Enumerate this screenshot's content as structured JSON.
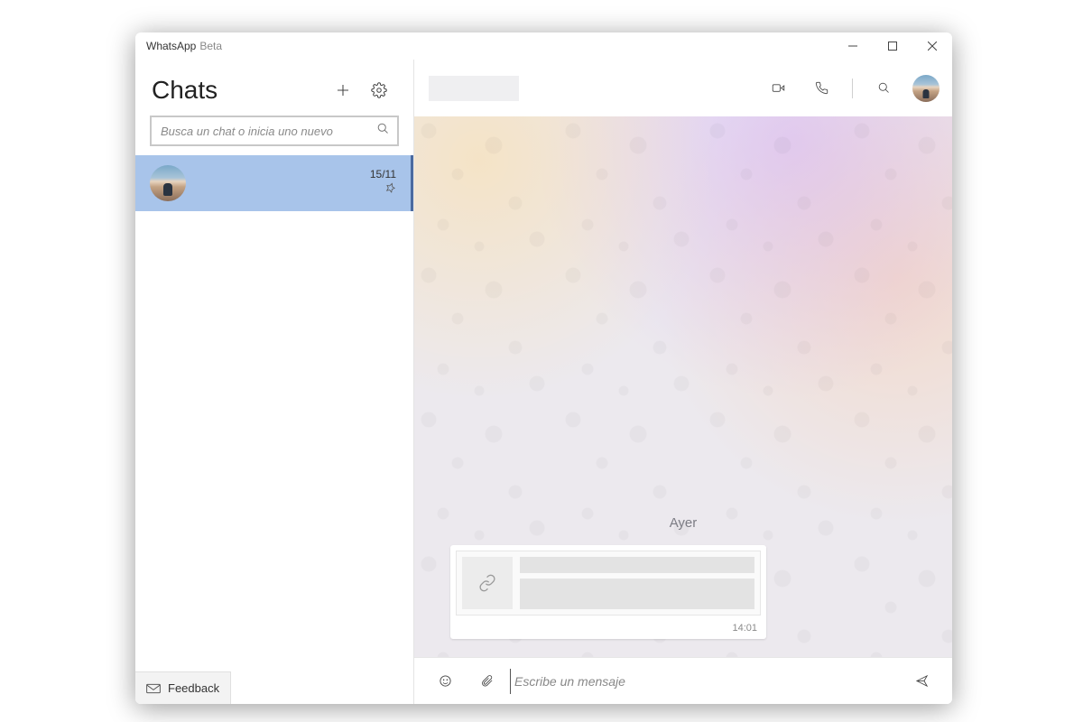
{
  "titlebar": {
    "app": "WhatsApp",
    "tag": "Beta"
  },
  "sidebar": {
    "title": "Chats",
    "search_placeholder": "Busca un chat o inicia uno nuevo",
    "feedback_label": "Feedback",
    "items": [
      {
        "date": "15/11",
        "pinned": true
      }
    ]
  },
  "chat": {
    "date_divider": "Ayer",
    "message_time": "14:01",
    "composer_placeholder": "Escribe un mensaje"
  }
}
